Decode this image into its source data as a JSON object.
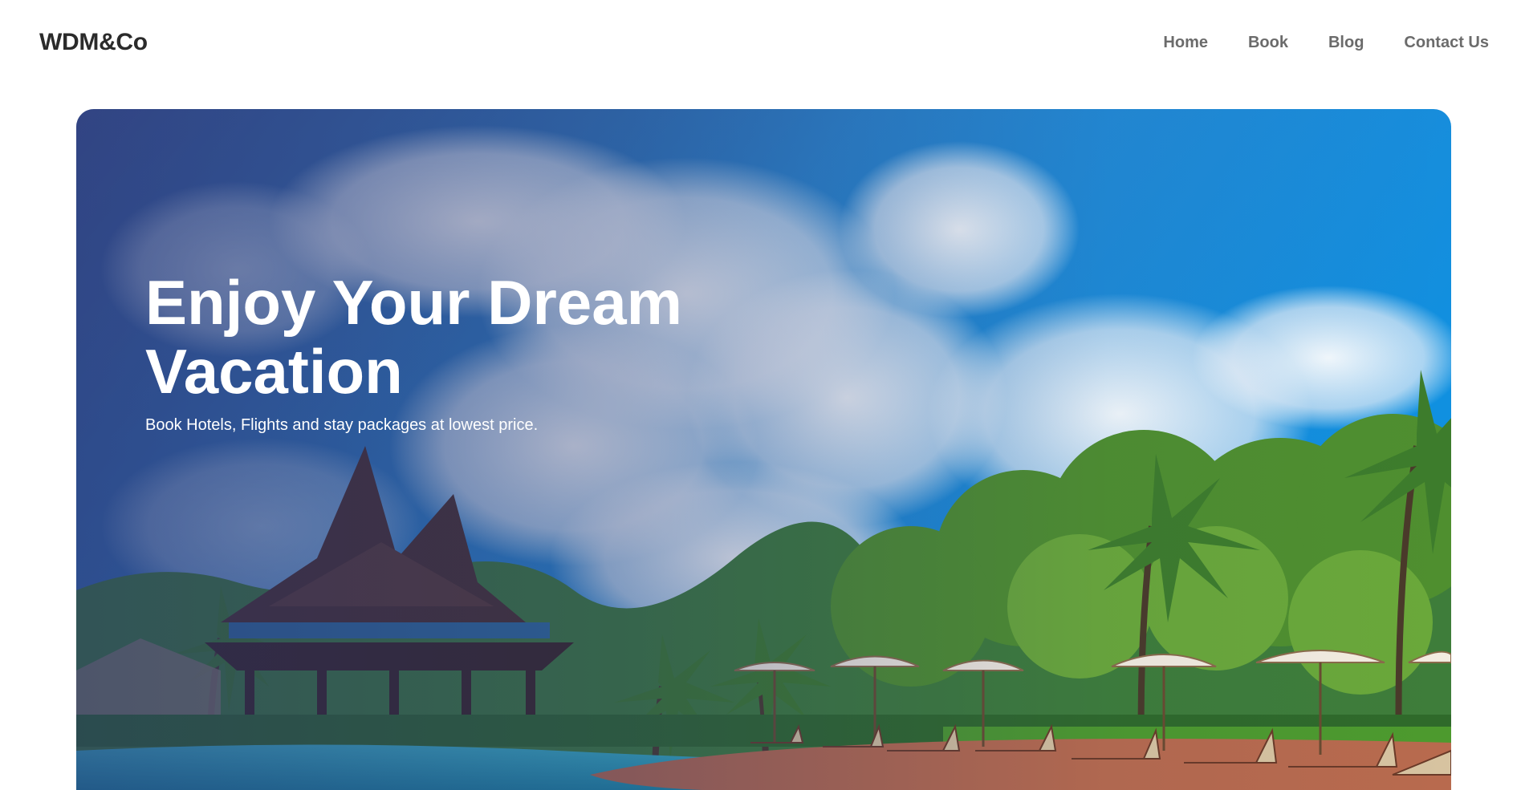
{
  "header": {
    "brand": "WDM&Co",
    "nav": [
      {
        "label": "Home"
      },
      {
        "label": "Book"
      },
      {
        "label": "Blog"
      },
      {
        "label": "Contact Us"
      }
    ]
  },
  "hero": {
    "title": "Enjoy Your Dream Vacation",
    "subtitle": "Book Hotels, Flights and stay packages at lowest price."
  },
  "colors": {
    "brand_text": "#2b2b2b",
    "nav_text": "#6b6b6b",
    "hero_text": "#ffffff",
    "sky": "#1e88d8",
    "pool": "#1fa7c0"
  }
}
